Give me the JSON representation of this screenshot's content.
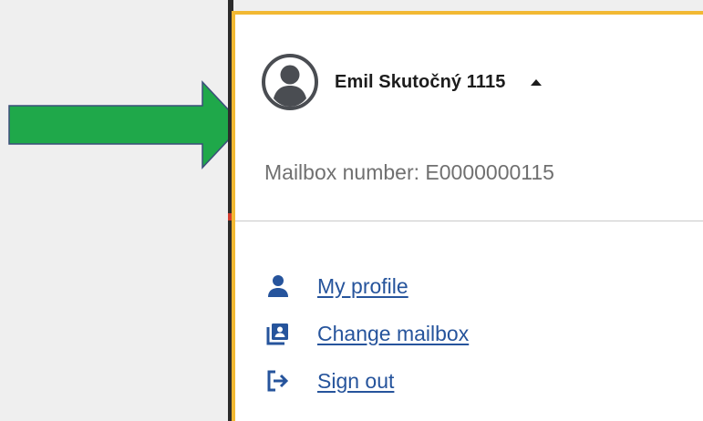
{
  "user_menu": {
    "user_name": "Emil Skutočný 1115",
    "mailbox_label": "Mailbox number:",
    "mailbox_number": "E0000000115",
    "expanded_icon": "caret-up-icon",
    "avatar_icon": "user-avatar-icon",
    "items": [
      {
        "label": "My profile",
        "icon": "person-icon"
      },
      {
        "label": "Change mailbox",
        "icon": "contacts-stack-icon"
      },
      {
        "label": "Sign out",
        "icon": "sign-out-icon"
      }
    ]
  },
  "annotation": {
    "arrow_icon": "right-arrow-icon"
  },
  "colors": {
    "background": "#efefef",
    "panel_border": "#f2b933",
    "link": "#26549c",
    "arrow_fill": "#1fa84a",
    "arrow_stroke": "#3b4e7a",
    "muted_text": "#707070",
    "heading_text": "#1c1c1c"
  }
}
